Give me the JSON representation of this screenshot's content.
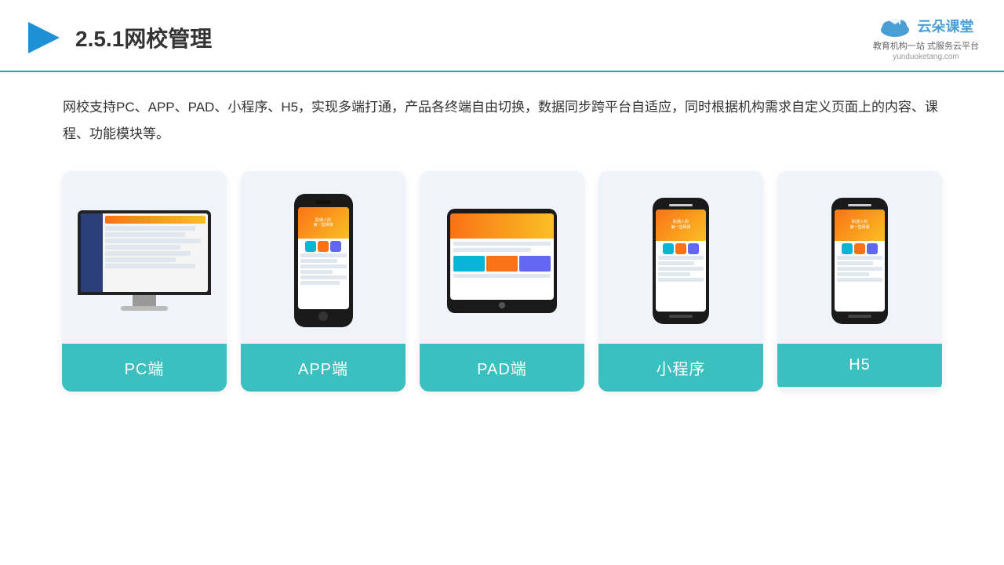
{
  "header": {
    "title": "2.5.1网校管理",
    "logo_name": "云朵课堂",
    "logo_url": "yunduoketang.com",
    "logo_tagline": "教育机构一站\n式服务云平台"
  },
  "description": "网校支持PC、APP、PAD、小程序、H5，实现多端打通，产品各终端自由切换，数据同步跨平台自适应，同时根据机构需求自定义页面上的内容、课程、功能模块等。",
  "cards": [
    {
      "id": "pc",
      "label": "PC端"
    },
    {
      "id": "app",
      "label": "APP端"
    },
    {
      "id": "pad",
      "label": "PAD端"
    },
    {
      "id": "miniprogram",
      "label": "小程序"
    },
    {
      "id": "h5",
      "label": "H5"
    }
  ],
  "accent_color": "#3bbfbf"
}
